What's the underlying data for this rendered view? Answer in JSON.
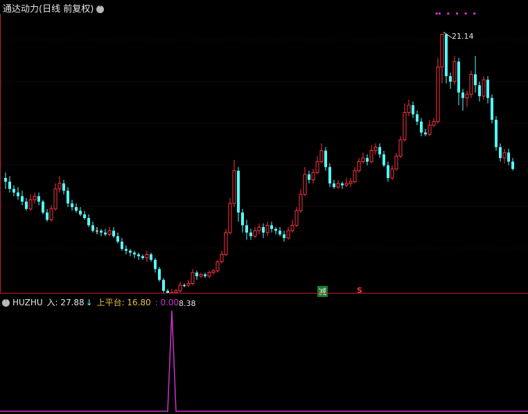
{
  "header": {
    "title": "通达动力(日线 前复权)",
    "menu_icon": "chevron-down-icon"
  },
  "indicator": {
    "name": "HUZHU",
    "in_label": "入: 27.88",
    "arrow": "↓",
    "platform_label": "上平台: 16.80",
    "value_label": ": 0.00",
    "colors": {
      "name": "#e6e6e6",
      "in": "#e6e6e6",
      "platform": "#e8c040",
      "value": "#cc33cc"
    }
  },
  "annotations": {
    "high_label": "21.14",
    "low_label": "8.38",
    "signal_reduce": "减",
    "signal_sell": "S"
  },
  "colors": {
    "up": "#ff3344",
    "down": "#54ffff",
    "flat": "#ffffff",
    "grid": "#3a0a10",
    "indicator_line": "#cc33cc",
    "divider": "#c02030"
  },
  "chart_data": [
    {
      "type": "candlestick",
      "title": "通达动力(日线 前复权)",
      "ylim": [
        7.0,
        22.3
      ],
      "high_annotation": 21.14,
      "low_annotation": 8.38,
      "candles": [
        [
          13.2,
          13.0,
          13.5,
          12.6
        ],
        [
          13.0,
          12.6,
          13.3,
          12.4
        ],
        [
          12.6,
          12.4,
          12.8,
          12.2
        ],
        [
          12.4,
          12.2,
          12.7,
          12.0
        ],
        [
          12.2,
          11.9,
          12.5,
          11.7
        ],
        [
          11.9,
          11.5,
          12.1,
          11.4
        ],
        [
          11.5,
          12.0,
          12.3,
          11.4
        ],
        [
          12.0,
          12.2,
          12.4,
          11.8
        ],
        [
          12.2,
          11.9,
          12.4,
          11.7
        ],
        [
          11.9,
          11.3,
          12.0,
          11.2
        ],
        [
          11.3,
          10.9,
          11.5,
          10.8
        ],
        [
          10.9,
          11.5,
          11.7,
          10.8
        ],
        [
          11.5,
          12.6,
          12.9,
          11.4
        ],
        [
          12.6,
          12.9,
          13.3,
          12.4
        ],
        [
          12.9,
          12.5,
          13.1,
          12.3
        ],
        [
          12.5,
          11.8,
          12.7,
          11.6
        ],
        [
          11.8,
          11.6,
          12.0,
          11.4
        ],
        [
          11.6,
          11.4,
          11.8,
          11.3
        ],
        [
          11.4,
          11.2,
          11.6,
          11.1
        ],
        [
          11.2,
          11.0,
          11.4,
          10.9
        ],
        [
          11.0,
          10.6,
          11.2,
          10.5
        ],
        [
          10.6,
          10.3,
          10.8,
          10.2
        ],
        [
          10.3,
          10.3,
          10.5,
          10.1
        ],
        [
          10.3,
          10.2,
          10.4,
          10.0
        ],
        [
          10.2,
          10.1,
          10.4,
          10.0
        ],
        [
          10.1,
          10.3,
          10.5,
          10.0
        ],
        [
          10.3,
          10.0,
          10.5,
          9.9
        ],
        [
          10.0,
          9.7,
          10.2,
          9.6
        ],
        [
          9.7,
          9.3,
          9.9,
          9.2
        ],
        [
          9.3,
          9.2,
          9.5,
          9.0
        ],
        [
          9.2,
          9.1,
          9.3,
          8.9
        ],
        [
          9.1,
          9.0,
          9.2,
          8.8
        ],
        [
          9.0,
          8.9,
          9.1,
          8.7
        ],
        [
          8.9,
          8.8,
          9.0,
          8.7
        ],
        [
          8.8,
          9.0,
          9.2,
          8.6
        ],
        [
          9.0,
          8.7,
          9.1,
          8.6
        ],
        [
          8.7,
          8.2,
          8.8,
          8.0
        ],
        [
          8.2,
          7.6,
          8.3,
          7.5
        ],
        [
          7.6,
          7.0,
          7.7,
          6.9
        ],
        [
          7.0,
          6.7,
          7.1,
          6.5
        ],
        [
          6.7,
          6.9,
          7.1,
          6.5
        ],
        [
          6.9,
          7.0,
          7.1,
          6.8
        ],
        [
          7.0,
          7.3,
          7.5,
          6.9
        ],
        [
          7.3,
          7.3,
          7.4,
          7.2
        ],
        [
          7.3,
          7.4,
          7.6,
          7.2
        ],
        [
          7.4,
          8.0,
          8.2,
          7.3
        ],
        [
          8.0,
          7.8,
          8.1,
          7.6
        ],
        [
          7.8,
          7.9,
          8.0,
          7.7
        ],
        [
          7.9,
          7.8,
          8.0,
          7.7
        ],
        [
          7.8,
          8.0,
          8.1,
          7.7
        ],
        [
          8.0,
          8.1,
          8.2,
          7.9
        ],
        [
          8.1,
          8.6,
          8.7,
          8.0
        ],
        [
          8.6,
          9.0,
          9.2,
          8.5
        ],
        [
          9.0,
          10.2,
          10.4,
          8.9
        ],
        [
          10.2,
          11.8,
          12.1,
          10.1
        ],
        [
          11.8,
          13.6,
          14.2,
          11.6
        ],
        [
          13.6,
          11.3,
          13.8,
          10.8
        ],
        [
          11.3,
          10.6,
          11.5,
          10.2
        ],
        [
          10.6,
          10.2,
          10.9,
          9.8
        ],
        [
          10.2,
          10.0,
          10.4,
          9.8
        ],
        [
          10.0,
          10.3,
          10.5,
          9.9
        ],
        [
          10.3,
          10.5,
          10.7,
          10.1
        ],
        [
          10.5,
          10.2,
          10.7,
          9.9
        ],
        [
          10.2,
          10.6,
          10.8,
          10.0
        ],
        [
          10.6,
          10.4,
          10.8,
          10.2
        ],
        [
          10.4,
          10.3,
          10.5,
          10.1
        ],
        [
          10.3,
          10.1,
          10.5,
          10.0
        ],
        [
          10.1,
          9.9,
          10.3,
          9.7
        ],
        [
          9.9,
          10.3,
          10.5,
          9.8
        ],
        [
          10.3,
          10.6,
          10.9,
          10.2
        ],
        [
          10.6,
          11.4,
          11.6,
          10.5
        ],
        [
          11.4,
          12.3,
          12.6,
          11.3
        ],
        [
          12.3,
          13.4,
          13.8,
          12.2
        ],
        [
          13.4,
          13.1,
          13.6,
          12.9
        ],
        [
          13.1,
          13.5,
          13.7,
          12.9
        ],
        [
          13.5,
          14.1,
          14.4,
          13.4
        ],
        [
          14.1,
          14.7,
          15.1,
          14.0
        ],
        [
          14.7,
          13.8,
          14.9,
          13.6
        ],
        [
          13.8,
          12.9,
          14.0,
          12.7
        ],
        [
          12.9,
          12.7,
          13.1,
          12.6
        ],
        [
          12.7,
          12.9,
          13.1,
          12.6
        ],
        [
          12.9,
          12.8,
          13.0,
          12.6
        ],
        [
          12.8,
          12.9,
          13.2,
          12.7
        ],
        [
          12.9,
          13.0,
          13.2,
          12.7
        ],
        [
          13.0,
          13.6,
          13.8,
          12.9
        ],
        [
          13.6,
          14.1,
          14.3,
          13.5
        ],
        [
          14.1,
          14.3,
          14.6,
          14.0
        ],
        [
          14.3,
          14.1,
          14.5,
          13.9
        ],
        [
          14.1,
          14.7,
          15.0,
          14.0
        ],
        [
          14.7,
          14.9,
          15.1,
          14.5
        ],
        [
          14.9,
          14.5,
          15.1,
          14.3
        ],
        [
          14.5,
          13.9,
          14.7,
          13.8
        ],
        [
          13.9,
          13.2,
          14.1,
          13.0
        ],
        [
          13.2,
          13.7,
          13.9,
          13.1
        ],
        [
          13.7,
          14.4,
          14.6,
          13.6
        ],
        [
          14.4,
          15.3,
          15.5,
          14.3
        ],
        [
          15.3,
          16.8,
          17.3,
          15.2
        ],
        [
          16.8,
          17.2,
          17.5,
          16.6
        ],
        [
          17.2,
          16.7,
          17.4,
          16.5
        ],
        [
          16.7,
          16.3,
          16.9,
          16.1
        ],
        [
          16.3,
          15.7,
          16.5,
          15.5
        ],
        [
          15.7,
          15.6,
          15.9,
          15.5
        ],
        [
          15.6,
          16.1,
          16.4,
          15.5
        ],
        [
          16.1,
          16.3,
          16.5,
          16.0
        ],
        [
          16.3,
          19.3,
          19.8,
          16.2
        ],
        [
          19.3,
          21.1,
          21.14,
          18.4
        ],
        [
          21.1,
          18.8,
          21.1,
          18.4
        ],
        [
          18.8,
          18.5,
          19.0,
          18.1
        ],
        [
          18.5,
          19.6,
          19.9,
          18.3
        ],
        [
          19.6,
          17.9,
          19.8,
          17.2
        ],
        [
          17.9,
          17.6,
          18.1,
          16.9
        ],
        [
          17.6,
          17.8,
          18.0,
          17.1
        ],
        [
          17.8,
          18.9,
          19.1,
          17.6
        ],
        [
          18.9,
          18.3,
          19.9,
          17.9
        ],
        [
          18.3,
          17.7,
          18.5,
          17.4
        ],
        [
          17.7,
          18.6,
          18.8,
          17.5
        ],
        [
          18.6,
          17.6,
          18.8,
          17.3
        ],
        [
          17.6,
          16.4,
          17.8,
          16.2
        ],
        [
          16.4,
          14.9,
          16.6,
          14.7
        ],
        [
          14.9,
          14.3,
          15.1,
          14.1
        ],
        [
          14.3,
          14.6,
          14.8,
          14.0
        ],
        [
          14.6,
          14.1,
          14.8,
          13.9
        ],
        [
          14.1,
          13.7,
          14.3,
          13.6
        ]
      ],
      "signals": {
        "reduce_index": 76,
        "sell_index": 85
      }
    },
    {
      "type": "line",
      "title": "HUZHU",
      "series": [
        {
          "name": "HUZHU",
          "values": "pulse"
        }
      ],
      "ylim": [
        0,
        28
      ],
      "pulse_index": 40,
      "pulse_value": 27.88
    }
  ]
}
